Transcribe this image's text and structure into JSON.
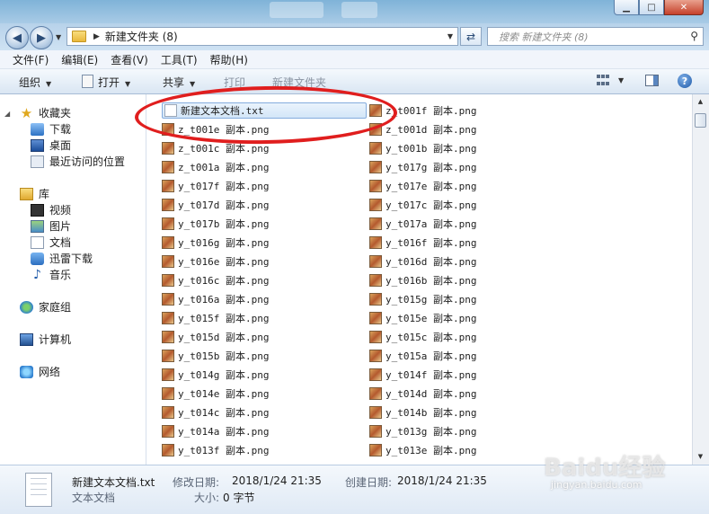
{
  "window": {
    "minimize_glyph": "▁",
    "maximize_glyph": "□",
    "close_glyph": "✕"
  },
  "address": {
    "path": "新建文件夹 (8)",
    "search_placeholder": "搜索 新建文件夹 (8)"
  },
  "menu": [
    "文件(F)",
    "编辑(E)",
    "查看(V)",
    "工具(T)",
    "帮助(H)"
  ],
  "toolbar": {
    "organize": "组织",
    "open": "打开",
    "share": "共享",
    "print": "打印",
    "new_folder": "新建文件夹"
  },
  "nav": {
    "favorites": "收藏夹",
    "downloads": "下载",
    "desktop": "桌面",
    "recent": "最近访问的位置",
    "libraries": "库",
    "videos": "视频",
    "pictures": "图片",
    "documents": "文档",
    "thunder": "迅雷下载",
    "music": "音乐",
    "homegroup": "家庭组",
    "computer": "计算机",
    "network": "网络"
  },
  "files": {
    "col1": [
      "新建文本文档.txt",
      "z_t001e 副本.png",
      "z_t001c 副本.png",
      "z_t001a 副本.png",
      "y_t017f 副本.png",
      "y_t017d 副本.png",
      "y_t017b 副本.png",
      "y_t016g 副本.png",
      "y_t016e 副本.png",
      "y_t016c 副本.png",
      "y_t016a 副本.png",
      "y_t015f 副本.png",
      "y_t015d 副本.png",
      "y_t015b 副本.png",
      "y_t014g 副本.png",
      "y_t014e 副本.png",
      "y_t014c 副本.png",
      "y_t014a 副本.png",
      "y_t013f 副本.png"
    ],
    "col2": [
      "z_t001f 副本.png",
      "z_t001d 副本.png",
      "y_t001b 副本.png",
      "y_t017g 副本.png",
      "y_t017e 副本.png",
      "y_t017c 副本.png",
      "y_t017a 副本.png",
      "y_t016f 副本.png",
      "y_t016d 副本.png",
      "y_t016b 副本.png",
      "y_t015g 副本.png",
      "y_t015e 副本.png",
      "y_t015c 副本.png",
      "y_t015a 副本.png",
      "y_t014f 副本.png",
      "y_t014d 副本.png",
      "y_t014b 副本.png",
      "y_t013g 副本.png",
      "y_t013e 副本.png"
    ]
  },
  "details": {
    "name": "新建文本文档.txt",
    "type": "文本文档",
    "modified_label": "修改日期:",
    "modified_value": "2018/1/24 21:35",
    "created_label": "创建日期:",
    "created_value": "2018/1/24 21:35",
    "size_label": "大小:",
    "size_value": "0 字节"
  },
  "watermark": {
    "line1": "Baidu经验",
    "line2": "jingyan.baidu.com"
  },
  "colors": {
    "annotation_oval": "#e01e1e",
    "selection_border": "#84acdd"
  }
}
